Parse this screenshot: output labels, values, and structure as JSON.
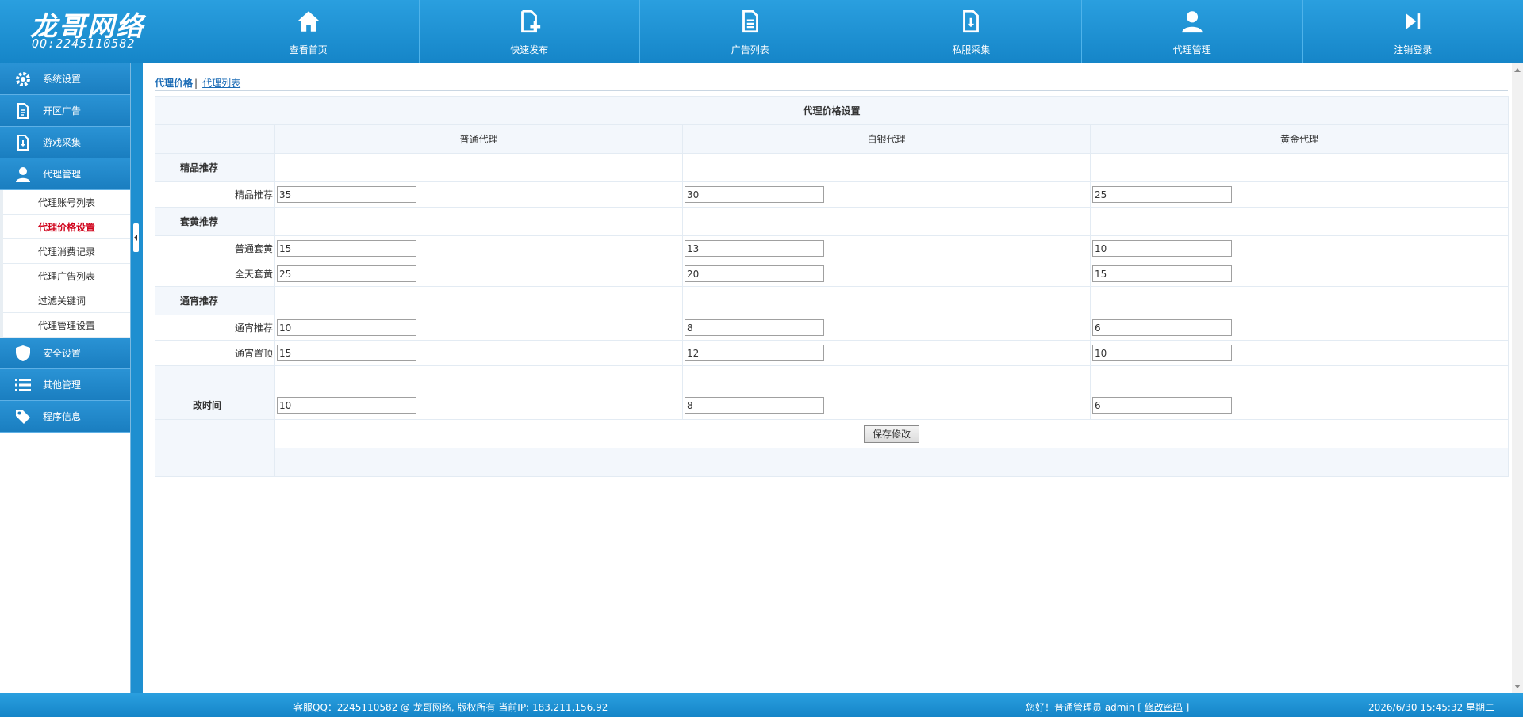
{
  "brand": {
    "title": "龙哥网络",
    "subtitle": "QQ:2245110582"
  },
  "nav": [
    {
      "label": "查看首页",
      "icon": "home-icon"
    },
    {
      "label": "快速发布",
      "icon": "add-doc-icon"
    },
    {
      "label": "广告列表",
      "icon": "doc-list-icon"
    },
    {
      "label": "私服采集",
      "icon": "download-doc-icon"
    },
    {
      "label": "代理管理",
      "icon": "user-icon"
    },
    {
      "label": "注销登录",
      "icon": "logout-icon"
    }
  ],
  "sidebar": {
    "groups": [
      {
        "label": "系统设置",
        "icon": "gear-icon"
      },
      {
        "label": "开区广告",
        "icon": "doc-icon"
      },
      {
        "label": "游戏采集",
        "icon": "download-doc-icon"
      },
      {
        "label": "代理管理",
        "icon": "user-icon"
      },
      {
        "label": "安全设置",
        "icon": "shield-icon"
      },
      {
        "label": "其他管理",
        "icon": "list-icon"
      },
      {
        "label": "程序信息",
        "icon": "tag-icon"
      }
    ],
    "sub_items": [
      {
        "label": "代理账号列表",
        "active": false
      },
      {
        "label": "代理价格设置",
        "active": true
      },
      {
        "label": "代理消费记录",
        "active": false
      },
      {
        "label": "代理广告列表",
        "active": false
      },
      {
        "label": "过滤关键词",
        "active": false
      },
      {
        "label": "代理管理设置",
        "active": false
      }
    ]
  },
  "tabs": {
    "current": "代理价格",
    "separator": "|",
    "link": "代理列表"
  },
  "form": {
    "title": "代理价格设置",
    "columns": [
      "普通代理",
      "白银代理",
      "黄金代理"
    ],
    "sections": [
      {
        "name": "精品推荐",
        "rows": [
          {
            "label": "精品推荐",
            "values": [
              "35",
              "30",
              "25"
            ]
          }
        ]
      },
      {
        "name": "套黄推荐",
        "rows": [
          {
            "label": "普通套黄",
            "values": [
              "15",
              "13",
              "10"
            ]
          },
          {
            "label": "全天套黄",
            "values": [
              "25",
              "20",
              "15"
            ]
          }
        ]
      },
      {
        "name": "通宵推荐",
        "rows": [
          {
            "label": "通宵推荐",
            "values": [
              "10",
              "8",
              "6"
            ]
          },
          {
            "label": "通宵置顶",
            "values": [
              "15",
              "12",
              "10"
            ]
          }
        ]
      }
    ],
    "time_row": {
      "label": "改时间",
      "values": [
        "10",
        "8",
        "6"
      ]
    },
    "save_label": "保存修改"
  },
  "footer": {
    "left": "客服QQ：2245110582   @ 龙哥网络, 版权所有   当前IP: 183.211.156.92",
    "greeting": "您好！普通管理员 admin [ ",
    "change_pwd": "修改密码",
    "greeting_end": " ]",
    "datetime": "2026/6/30 15:45:32 星期二"
  },
  "colors": {
    "header": "#1e8fd0",
    "active_sub": "#d0021b",
    "link": "#1a6bb5"
  }
}
